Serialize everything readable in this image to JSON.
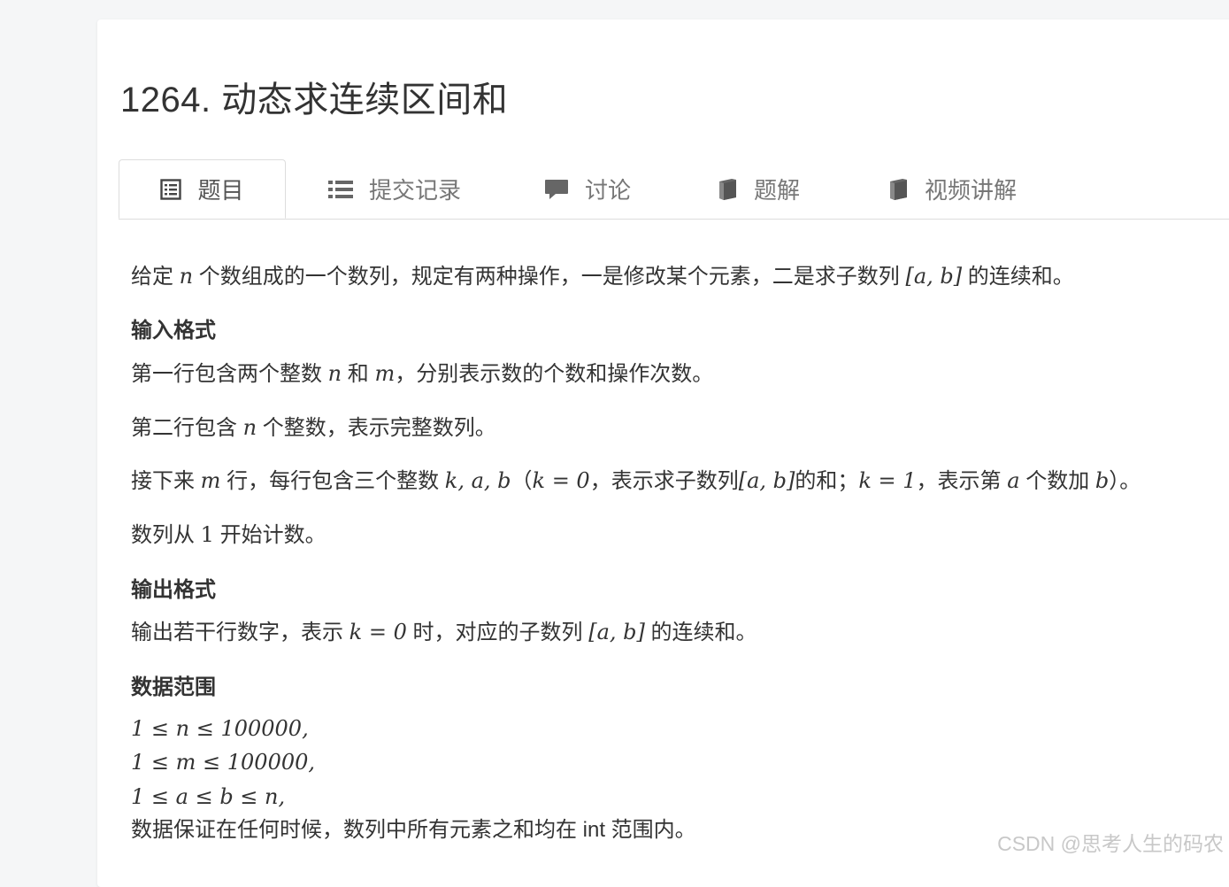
{
  "problem": {
    "title": "1264. 动态求连续区间和"
  },
  "tabs": [
    {
      "label": "题目",
      "icon": "list-alt-icon"
    },
    {
      "label": "提交记录",
      "icon": "list-icon"
    },
    {
      "label": "讨论",
      "icon": "comment-icon"
    },
    {
      "label": "题解",
      "icon": "book-icon"
    },
    {
      "label": "视频讲解",
      "icon": "book-icon"
    }
  ],
  "statement": {
    "desc_prefix": "给定 ",
    "desc_n": "n",
    "desc_mid": " 个数组成的一个数列，规定有两种操作，一是修改某个元素，二是求子数列 ",
    "desc_range": "[a, b]",
    "desc_suffix": " 的连续和。"
  },
  "input": {
    "heading": "输入格式",
    "line1_a": "第一行包含两个整数 ",
    "line1_n": "n",
    "line1_b": " 和 ",
    "line1_m": "m",
    "line1_c": "，分别表示数的个数和操作次数。",
    "line2_a": "第二行包含 ",
    "line2_n": "n",
    "line2_b": " 个整数，表示完整数列。",
    "line3_a": "接下来 ",
    "line3_m": "m",
    "line3_b": " 行，每行包含三个整数 ",
    "line3_kab": "k, a, b",
    "line3_c": "（",
    "line3_k0": "k = 0",
    "line3_d": "，表示求子数列",
    "line3_range": "[a, b]",
    "line3_e": "的和；",
    "line3_k1": "k = 1",
    "line3_f": "，表示第 ",
    "line3_a_var": "a",
    "line3_g": " 个数加 ",
    "line3_b_var": "b",
    "line3_h": "）。",
    "line4_a": "数列从 ",
    "line4_one": "1",
    "line4_b": " 开始计数。"
  },
  "output": {
    "heading": "输出格式",
    "line_a": "输出若干行数字，表示 ",
    "line_k0": "k = 0",
    "line_b": " 时，对应的子数列 ",
    "line_range": "[a, b]",
    "line_c": " 的连续和。"
  },
  "range": {
    "heading": "数据范围",
    "c1": "1 ≤ n ≤ 100000,",
    "c2": "1 ≤ m ≤ 100000,",
    "c3": "1 ≤ a ≤ b ≤ n,",
    "c4": "数据保证在任何时候，数列中所有元素之和均在 int 范围内。"
  },
  "watermark": "CSDN @思考人生的码农"
}
